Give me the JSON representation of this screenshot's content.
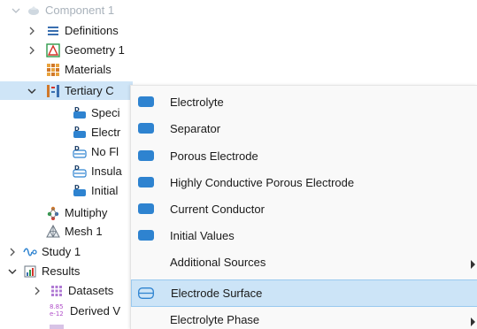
{
  "tree": {
    "component": "Component 1",
    "definitions": "Definitions",
    "geometry": "Geometry 1",
    "materials": "Materials",
    "tertiary": "Tertiary C",
    "species": "Speci",
    "electrolyte": "Electr",
    "no_flux": "No Fl",
    "insulation": "Insula",
    "initial": "Initial",
    "multiphysics": "Multiphy",
    "mesh": "Mesh 1",
    "study": "Study 1",
    "results": "Results",
    "datasets": "Datasets",
    "derived": "Derived V",
    "derived_icon_text_top": "8.85",
    "derived_icon_text_bottom": "e-12"
  },
  "menu": {
    "items": [
      {
        "label": "Electrolyte",
        "icon": "domain-feature-icon",
        "submenu": false
      },
      {
        "label": "Separator",
        "icon": "domain-feature-icon",
        "submenu": false
      },
      {
        "label": "Porous Electrode",
        "icon": "domain-feature-icon",
        "submenu": false
      },
      {
        "label": "Highly Conductive Porous Electrode",
        "icon": "domain-feature-icon",
        "submenu": false
      },
      {
        "label": "Current Conductor",
        "icon": "domain-feature-icon",
        "submenu": false
      },
      {
        "label": "Initial Values",
        "icon": "domain-feature-icon",
        "submenu": false
      },
      {
        "label": "Additional Sources",
        "icon": "",
        "submenu": true
      },
      {
        "label": "Electrode Surface",
        "icon": "boundary-feature-icon",
        "submenu": false
      },
      {
        "label": "Electrolyte Phase",
        "icon": "",
        "submenu": true
      }
    ],
    "highlighted_index": 7
  },
  "colors": {
    "accent_blue": "#2e83d0",
    "highlight": "#cce4f7",
    "selection": "#cfe5f7"
  }
}
